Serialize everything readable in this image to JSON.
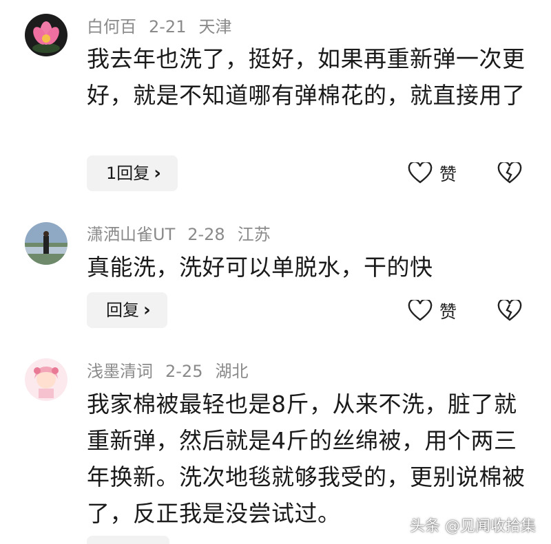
{
  "comments": [
    {
      "user": "白何百",
      "date": "2-21",
      "location": "天津",
      "text": "我去年也洗了，挺好，如果再重新弹一次更好，就是不知道哪有弹棉花的，就直接用了",
      "reply_label": "1回复",
      "like_label": "赞",
      "avatar_icon": "pink-lotus-avatar"
    },
    {
      "user": "潇洒山雀UT",
      "date": "2-28",
      "location": "江苏",
      "text": "真能洗，洗好可以单脱水，干的快",
      "reply_label": "回复",
      "like_label": "赞",
      "avatar_icon": "person-outdoor-avatar"
    },
    {
      "user": "浅墨清词",
      "date": "2-25",
      "location": "湖北",
      "text": "我家棉被最轻也是8斤，从来不洗，脏了就重新弹，然后就是4斤的丝绵被，用个两三年换新。洗次地毯就够我受的，更别说棉被了，反正我是没尝试过。",
      "avatar_icon": "anime-girl-avatar"
    }
  ],
  "watermark": "头条 @见闻收拾集",
  "colors": {
    "meta": "#8a8a8a",
    "button_bg": "#f2f2f2",
    "text": "#1a1a1a"
  }
}
